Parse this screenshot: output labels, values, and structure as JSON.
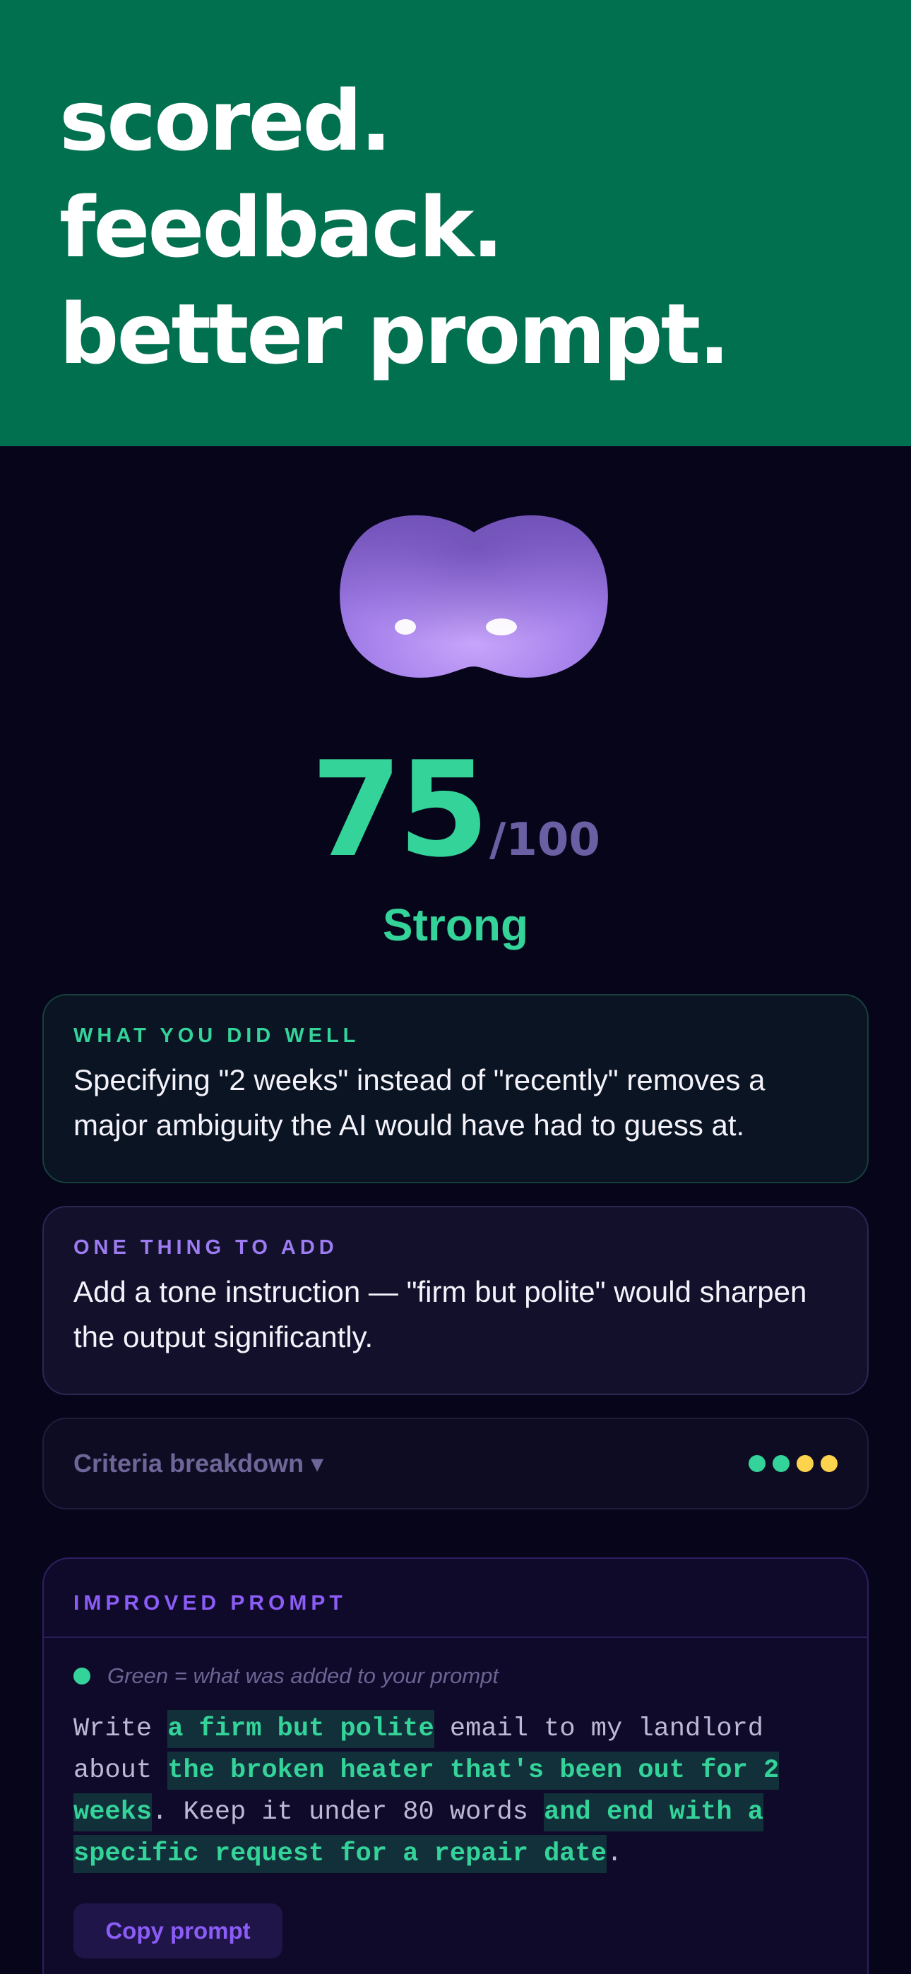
{
  "hero": {
    "lines": [
      "scored.",
      "feedback.",
      "better prompt."
    ]
  },
  "score": {
    "value": "75",
    "max_suffix": "/100",
    "rating": "Strong"
  },
  "did_well": {
    "label": "WHAT YOU DID WELL",
    "text": "Specifying \"2 weeks\" instead of \"recently\" removes a major ambiguity the AI would have had to guess at."
  },
  "one_thing": {
    "label": "ONE THING TO ADD",
    "text": "Add a tone instruction — \"firm but polite\" would sharpen the output significantly."
  },
  "criteria": {
    "label": "Criteria breakdown ▾",
    "dot_colors": [
      "#34d399",
      "#34d399",
      "#fcd34d",
      "#fcd34d"
    ]
  },
  "improved": {
    "title": "IMPROVED PROMPT",
    "legend": "Green = what was added to your prompt",
    "segments": [
      {
        "text": "Write ",
        "added": false
      },
      {
        "text": "a firm but polite",
        "added": true
      },
      {
        "text": " email to my landlord about ",
        "added": false
      },
      {
        "text": "the broken heater that's been out for 2 weeks",
        "added": true
      },
      {
        "text": ". Keep it under 80 words ",
        "added": false
      },
      {
        "text": "and end with a specific request for a repair date",
        "added": true
      },
      {
        "text": ".",
        "added": false
      }
    ],
    "copy_label": "Copy prompt"
  },
  "colors": {
    "hero_bg": "#01704f",
    "accent_green": "#34d399",
    "accent_purple": "#8b5cf6",
    "page_bg": "#06051a"
  }
}
